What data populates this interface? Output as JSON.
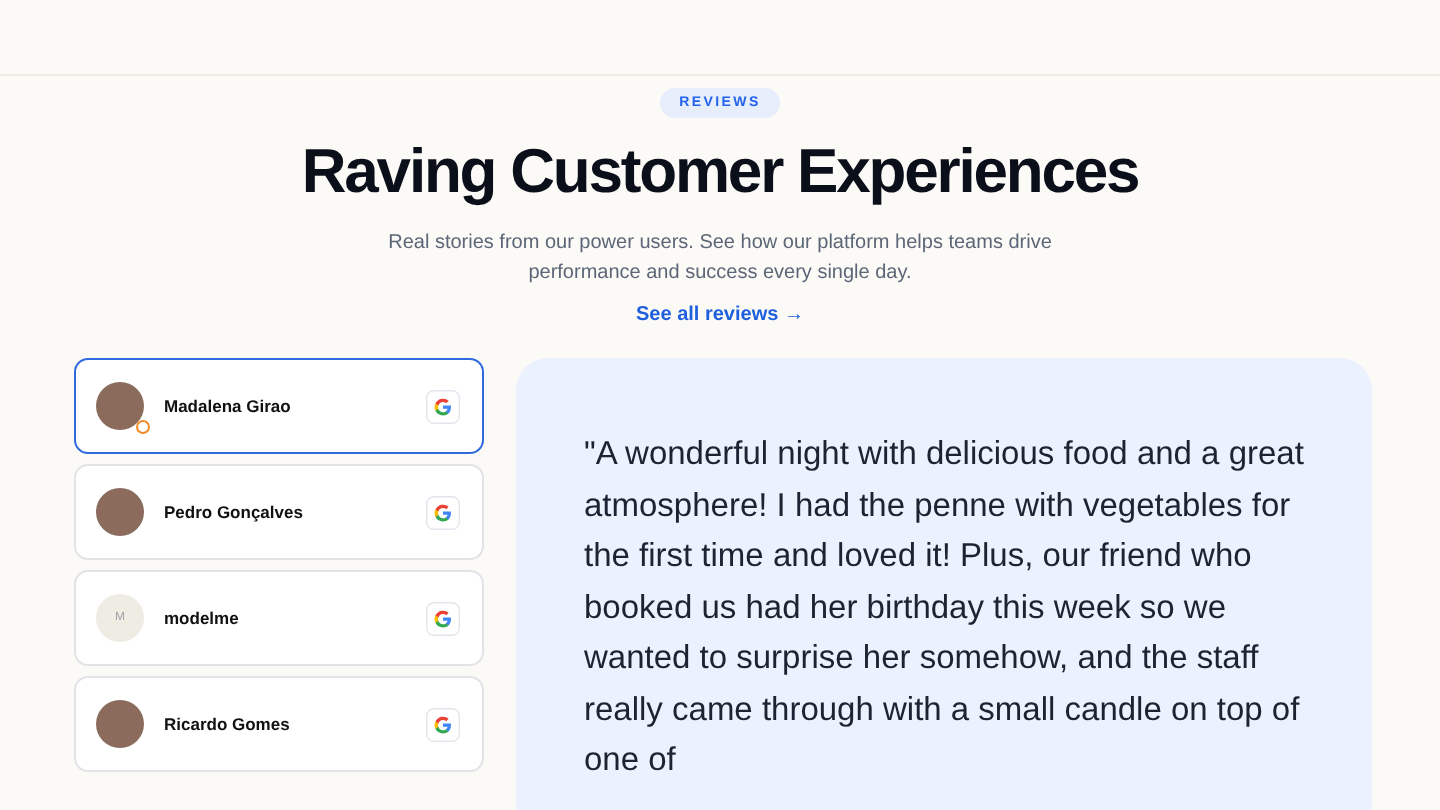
{
  "badge": "REVIEWS",
  "heading": "Raving Customer Experiences",
  "subtitle": "Real stories from our power users. See how our platform helps teams drive performance and success every single day.",
  "link": {
    "label": "See all reviews",
    "arrow": "→"
  },
  "reviewers": [
    {
      "name": "Madalena Girao",
      "selected": true,
      "kind": "photo",
      "badge": true
    },
    {
      "name": "Pedro Gonçalves",
      "selected": false,
      "kind": "photo",
      "badge": false
    },
    {
      "name": "modelme",
      "selected": false,
      "kind": "initial",
      "initial": "M",
      "badge": false
    },
    {
      "name": "Ricardo Gomes",
      "selected": false,
      "kind": "photo",
      "badge": false
    }
  ],
  "quote": "\"A wonderful night with delicious food and a great atmosphere! I had the penne with vegetables for the first time and loved it! Plus, our friend who booked us had her birthday this week so we wanted to surprise her somehow, and the staff really came through with a small candle on top of one of"
}
